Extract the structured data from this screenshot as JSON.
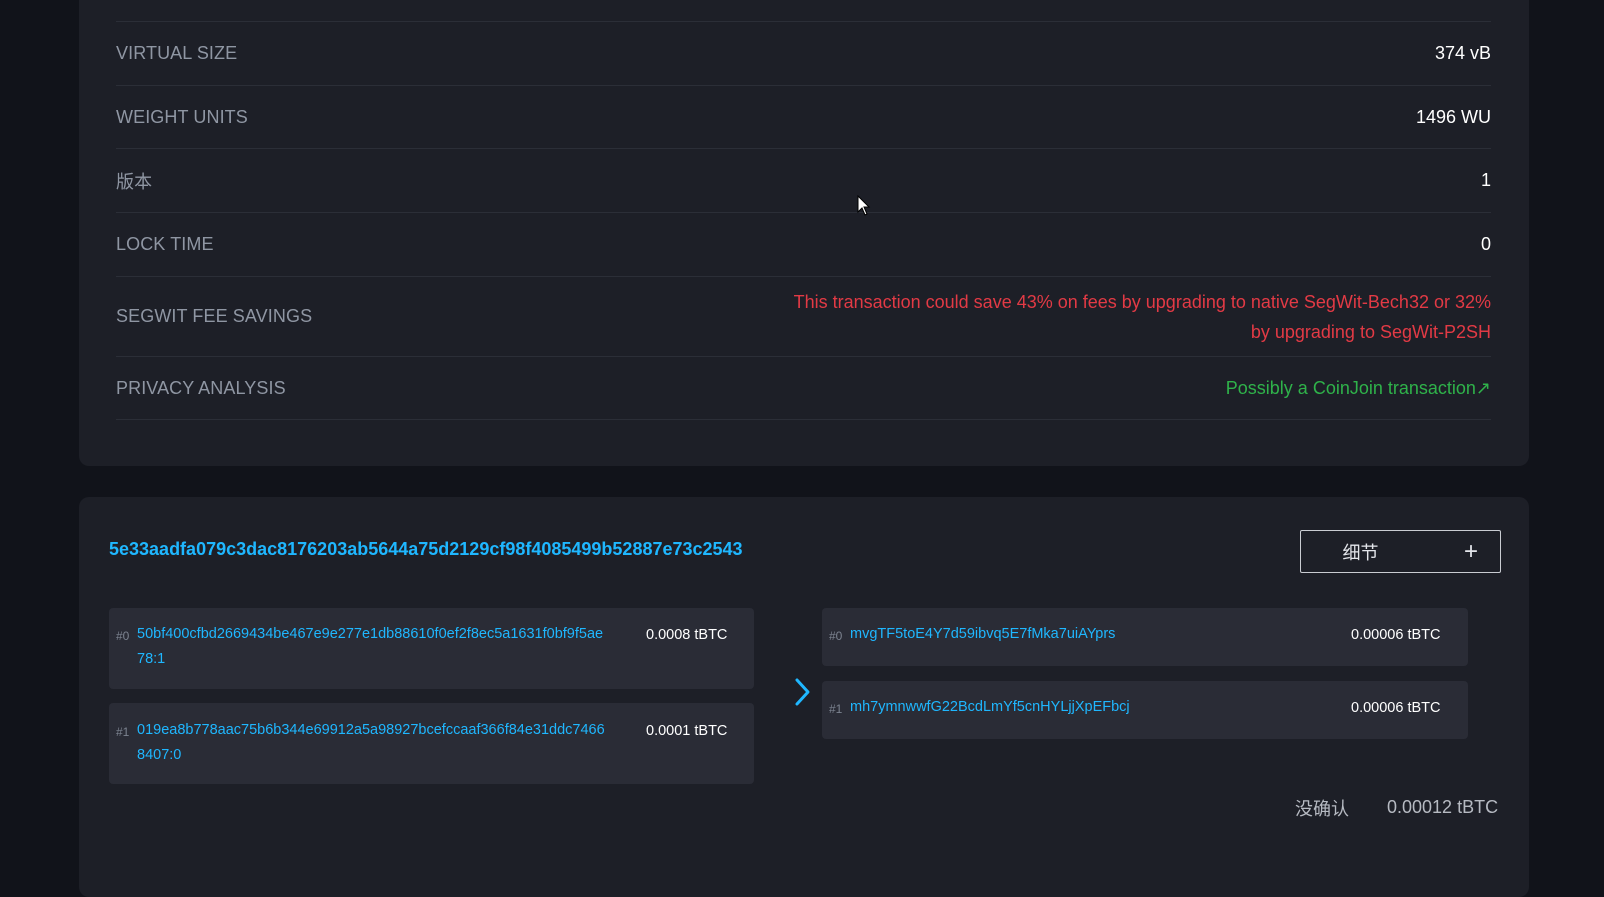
{
  "details": {
    "rows": [
      {
        "label": "VIRTUAL SIZE",
        "value": "374 vB"
      },
      {
        "label": "WEIGHT UNITS",
        "value": "1496 WU"
      },
      {
        "label": "版本",
        "value": "1"
      },
      {
        "label": "LOCK TIME",
        "value": "0"
      },
      {
        "label": "SEGWIT FEE SAVINGS",
        "value": "This transaction could save 43% on fees by upgrading to native SegWit-Bech32 or 32% by upgrading to SegWit-P2SH"
      },
      {
        "label": "PRIVACY ANALYSIS",
        "value": "Possibly a CoinJoin transaction↗"
      }
    ]
  },
  "tx": {
    "hash": "5e33aadfa079c3dac8176203ab5644a75d2129cf98f4085499b52887e73c2543",
    "details_button": "细节",
    "details_button_icon": "plus-icon",
    "inputs": [
      {
        "index": "#0",
        "address": "50bf400cfbd2669434be467e9e277e1db88610f0ef2f8ec5a1631f0bf9f5ae78:1",
        "amount": "0.0008 tBTC"
      },
      {
        "index": "#1",
        "address": "019ea8b778aac75b6b344e69912a5a98927bcefccaaf366f84e31ddc74668407:0",
        "amount": "0.0001 tBTC"
      }
    ],
    "outputs": [
      {
        "index": "#0",
        "address": "mvgTF5toE4Y7d59ibvq5E7fMka7uiAYprs",
        "amount": "0.00006 tBTC"
      },
      {
        "index": "#1",
        "address": "mh7ymnwwfG22BcdLmYf5cnHYLjjXpEFbcj",
        "amount": "0.00006 tBTC"
      }
    ],
    "arrow_icon": "chevron-right-icon",
    "status": "没确认",
    "total": "0.00012 tBTC"
  },
  "colors": {
    "link": "#1fb7ff",
    "warning": "#e23a45",
    "success": "#2fb24a",
    "card": "#1d1f27",
    "background": "#11131a"
  }
}
